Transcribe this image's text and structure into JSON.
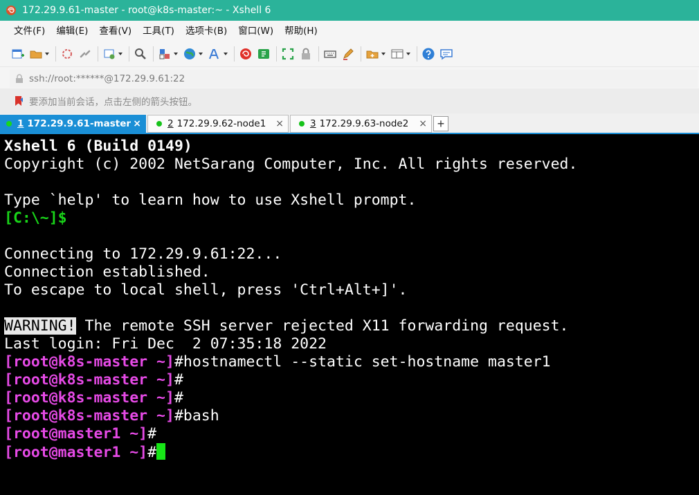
{
  "window": {
    "title": "172.29.9.61-master - root@k8s-master:~ - Xshell 6"
  },
  "menu": [
    "文件(F)",
    "编辑(E)",
    "查看(V)",
    "工具(T)",
    "选项卡(B)",
    "窗口(W)",
    "帮助(H)"
  ],
  "address": {
    "text": "ssh://root:******@172.29.9.61:22"
  },
  "hint": {
    "text": "要添加当前会话，点击左侧的箭头按钮。"
  },
  "tabs": [
    {
      "num": "1",
      "label": "172.29.9.61-master",
      "close": "×"
    },
    {
      "num": "2",
      "label": "172.29.9.62-node1",
      "close": "×"
    },
    {
      "num": "3",
      "label": "172.29.9.63-node2",
      "close": "×"
    }
  ],
  "new_tab": "+",
  "terminal": {
    "banner_title": "Xshell 6 (Build 0149)",
    "copyright": "Copyright (c) 2002 NetSarang Computer, Inc. All rights reserved.",
    "help_line": "Type `help' to learn how to use Xshell prompt.",
    "local_prompt": "[C:\\~]$",
    "connecting": "Connecting to 172.29.9.61:22...",
    "established": "Connection established.",
    "escape": "To escape to local shell, press 'Ctrl+Alt+]'.",
    "warning_tag": "WARNING!",
    "warning_msg": " The remote SSH server rejected X11 forwarding request.",
    "last_login": "Last login: Fri Dec  2 07:35:18 2022",
    "prompt_k8s": "[root@k8s-master ~]",
    "prompt_master1": "[root@master1 ~]",
    "hash": "#",
    "cmd1": "hostnamectl --static set-hostname master1",
    "cmd4": "bash"
  }
}
